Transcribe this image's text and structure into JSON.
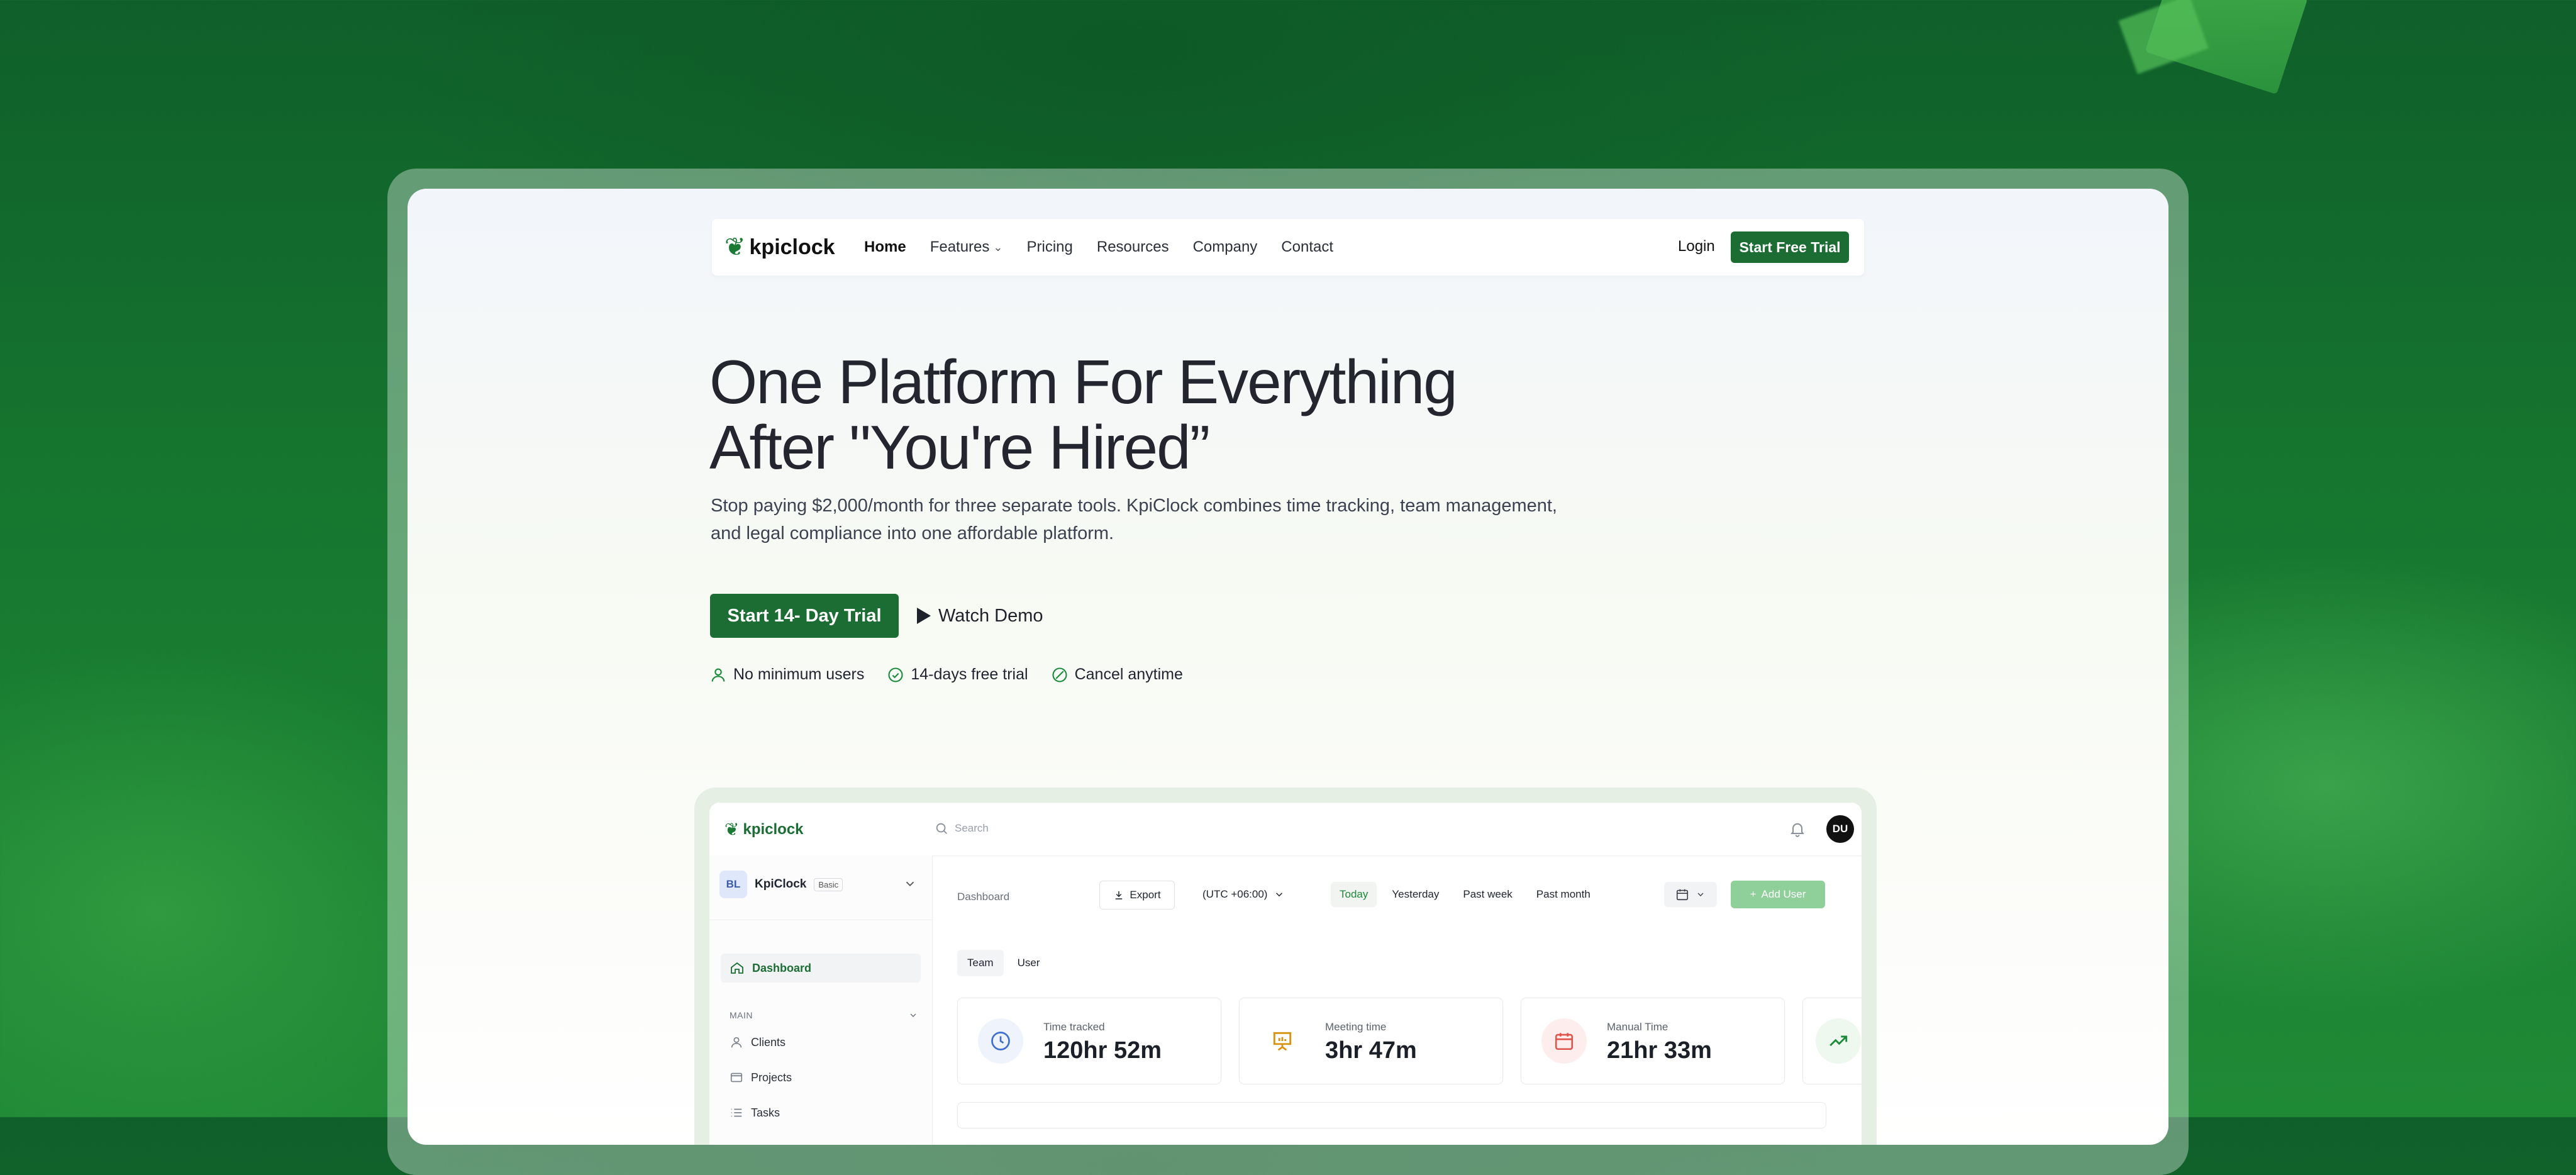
{
  "brand": {
    "name": "kpiclock",
    "mark": "❦"
  },
  "nav": {
    "links": [
      {
        "label": "Home",
        "active": true
      },
      {
        "label": "Features",
        "dropdown": true
      },
      {
        "label": "Pricing"
      },
      {
        "label": "Resources"
      },
      {
        "label": "Company"
      },
      {
        "label": "Contact"
      }
    ],
    "login": "Login",
    "cta": "Start Free Trial"
  },
  "hero": {
    "title_line1": "One Platform For Everything",
    "title_line2": "After \"You're Hired”",
    "subtitle_line1": "Stop paying $2,000/month for three separate tools. KpiClock combines time tracking, team management,",
    "subtitle_line2": "and legal compliance into one affordable platform.",
    "primary_cta": "Start 14- Day Trial",
    "demo_cta": "Watch Demo",
    "perks": [
      "No minimum users",
      "14-days free trial",
      "Cancel anytime"
    ]
  },
  "dashboard": {
    "search_placeholder": "Search",
    "avatar": "DU",
    "workspace": {
      "badge": "BL",
      "name": "KpiClock",
      "plan": "Basic"
    },
    "sidebar": {
      "active": "Dashboard",
      "section": "MAIN",
      "items": [
        "Clients",
        "Projects",
        "Tasks"
      ]
    },
    "breadcrumb": "Dashboard",
    "export": "Export",
    "timezone": "(UTC +06:00)",
    "ranges": [
      "Today",
      "Yesterday",
      "Past week",
      "Past month"
    ],
    "add_user": "Add User",
    "tabs": [
      "Team",
      "User"
    ],
    "stats": [
      {
        "label": "Time tracked",
        "value": "120hr 52m",
        "color": "#3f6fd1",
        "bg": "#eef3fc"
      },
      {
        "label": "Meeting time",
        "value": "3hr 47m",
        "color": "#d9930f",
        "bg": "#ffffff"
      },
      {
        "label": "Manual Time",
        "value": "21hr 33m",
        "color": "#e0534a",
        "bg": "#fdeeed"
      }
    ]
  },
  "colors": {
    "brand_green": "#1b6d33",
    "accent_green": "#1b8a3a"
  }
}
